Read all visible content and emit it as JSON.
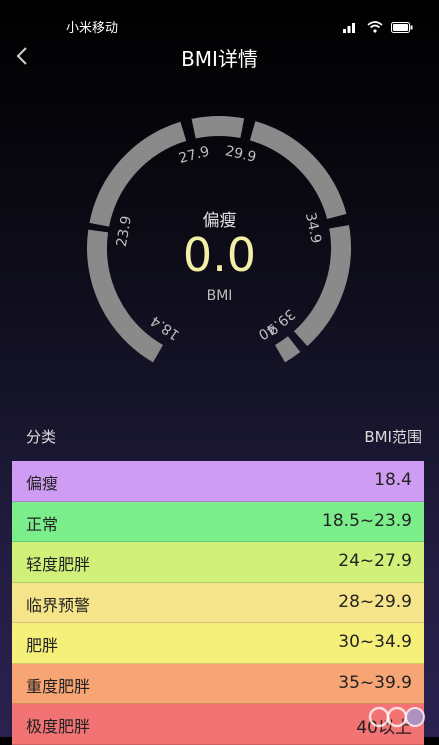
{
  "status_bar": {
    "carrier": "小米移动"
  },
  "header": {
    "title": "BMI详情"
  },
  "gauge": {
    "label": "偏瘦",
    "value": "0.0",
    "unit": "BMI",
    "ticks": [
      "18.4",
      "23.9",
      "27.9",
      "29.9",
      "34.9",
      "39.9",
      "40"
    ]
  },
  "table": {
    "header": {
      "category": "分类",
      "range": "BMI范围"
    },
    "rows": [
      {
        "category": "偏瘦",
        "range": "18.4",
        "color": "#cf9cf3"
      },
      {
        "category": "正常",
        "range": "18.5~23.9",
        "color": "#7bee8b"
      },
      {
        "category": "轻度肥胖",
        "range": "24~27.9",
        "color": "#d0f07a"
      },
      {
        "category": "临界预警",
        "range": "28~29.9",
        "color": "#f6e48a"
      },
      {
        "category": "肥胖",
        "range": "30~34.9",
        "color": "#f4f07a"
      },
      {
        "category": "重度肥胖",
        "range": "35~39.9",
        "color": "#f7a574"
      },
      {
        "category": "极度肥胖",
        "range": "40以上",
        "color": "#f27373"
      }
    ]
  },
  "colors": {
    "gauge_arc": "#8a8a8a",
    "value": "#f2efa6"
  },
  "icons": [
    "back-icon",
    "signal-icon",
    "wifi-icon",
    "battery-icon",
    "watermark-logo"
  ]
}
